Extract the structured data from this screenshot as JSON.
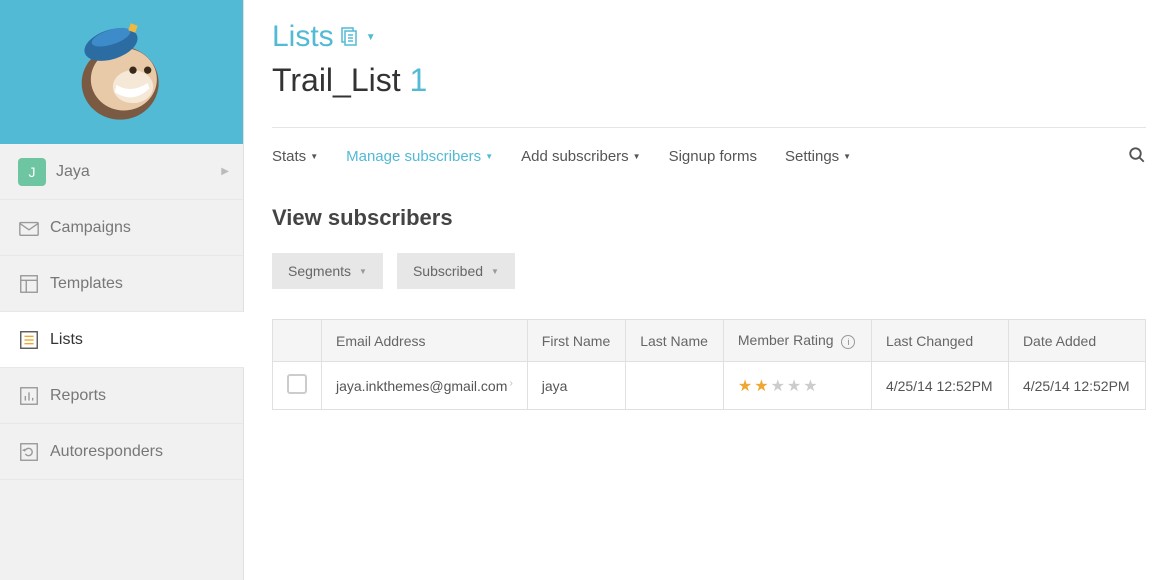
{
  "sidebar": {
    "user": {
      "initial": "J",
      "name": "Jaya"
    },
    "items": [
      {
        "label": "Campaigns"
      },
      {
        "label": "Templates"
      },
      {
        "label": "Lists"
      },
      {
        "label": "Reports"
      },
      {
        "label": "Autoresponders"
      }
    ]
  },
  "header": {
    "breadcrumb": "Lists",
    "title_text": "Trail_List",
    "title_num": "1"
  },
  "tabs": {
    "stats": "Stats",
    "manage": "Manage subscribers",
    "add": "Add subscribers",
    "signup": "Signup forms",
    "settings": "Settings"
  },
  "subheader": {
    "title": "View subscribers",
    "filter_segments": "Segments",
    "filter_subscribed": "Subscribed"
  },
  "table": {
    "cols": {
      "email": "Email Address",
      "first": "First Name",
      "last": "Last Name",
      "rating": "Member Rating",
      "changed": "Last Changed",
      "added": "Date Added"
    },
    "rows": [
      {
        "email": "jaya.inkthemes@gmail.com",
        "first": "jaya",
        "last": "",
        "rating": 2,
        "changed": "4/25/14 12:52PM",
        "added": "4/25/14 12:52PM"
      }
    ]
  }
}
